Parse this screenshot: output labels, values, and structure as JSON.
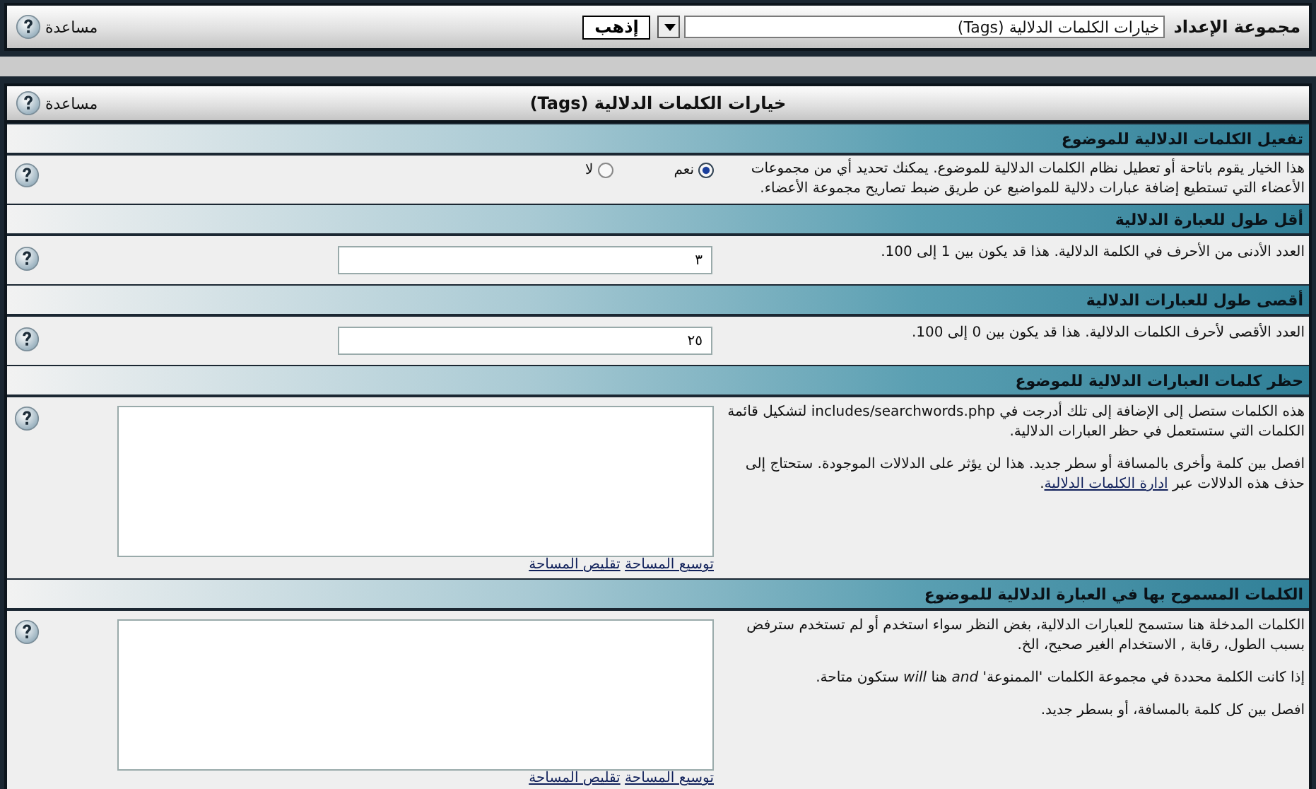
{
  "top_bar": {
    "label": "مجموعة الإعداد",
    "select_value": "خيارات الكلمات الدلالية (Tags)",
    "go_button": "إذهب",
    "help": "مساعدة"
  },
  "panel": {
    "title": "خيارات الكلمات الدلالية (Tags)",
    "help": "مساعدة"
  },
  "settings": [
    {
      "kind": "radio",
      "title": "تفعيل الكلمات الدلالية للموضوع",
      "paragraphs": [
        {
          "text": "هذا الخيار يقوم باتاحة أو تعطيل نظام الكلمات الدلالية للموضوع. يمكنك تحديد أي من مجموعات الأعضاء التي تستطيع إضافة عبارات دلالية للمواضيع عن طريق ضبط تصاريح مجموعة الأعضاء."
        }
      ],
      "options": [
        {
          "label": "نعم",
          "selected": true
        },
        {
          "label": "لا",
          "selected": false
        }
      ]
    },
    {
      "kind": "text",
      "title": "أقل طول للعبارة الدلالية",
      "paragraphs": [
        {
          "text": "العدد الأدنى من الأحرف في الكلمة الدلالية. هذا قد يكون بين 1 إلى 100."
        }
      ],
      "value": "٣"
    },
    {
      "kind": "text",
      "title": "أقصى طول للعبارات الدلالية",
      "paragraphs": [
        {
          "text": "العدد الأقصى لأحرف الكلمات الدلالية. هذا قد يكون بين 0 إلى 100."
        }
      ],
      "value": "٢٥"
    },
    {
      "kind": "textarea",
      "title": "حظر كلمات العبارات الدلالية للموضوع",
      "paragraphs": [
        {
          "text": "هذه الكلمات ستصل إلى الإضافة إلى تلك أدرجت في includes/searchwords.php لتشكيل قائمة الكلمات التي ستستعمل في حظر العبارات الدلالية."
        },
        {
          "text": "افصل بين كلمة وأخرى بالمسافة أو سطر جديد. هذا لن يؤثر على الدلالات الموجودة. ستحتاج إلى حذف هذه الدلالات عبر",
          "link": "ادارة الكلمات الدلالية",
          "after": "."
        }
      ],
      "links": [
        "توسيع المساحة",
        "تقليص المساحة"
      ]
    },
    {
      "kind": "textarea",
      "title": "الكلمات المسموح بها في العبارة الدلالية للموضوع",
      "paragraphs": [
        {
          "text": "الكلمات المدخلة هنا ستسمح للعبارات الدلالية، بغض النظر سواء استخدم أو لم تستخدم سترفض بسبب الطول، رقابة , الاستخدام الغير صحيح، الخ."
        },
        {
          "text": "إذا كانت الكلمة محددة في مجموعة الكلمات 'الممنوعة' *and* هنا *will* ستكون متاحة."
        },
        {
          "text": "افصل بين كل كلمة بالمسافة، أو بسطر جديد."
        }
      ],
      "links": [
        "توسيع المساحة",
        "تقليص المساحة"
      ]
    }
  ]
}
